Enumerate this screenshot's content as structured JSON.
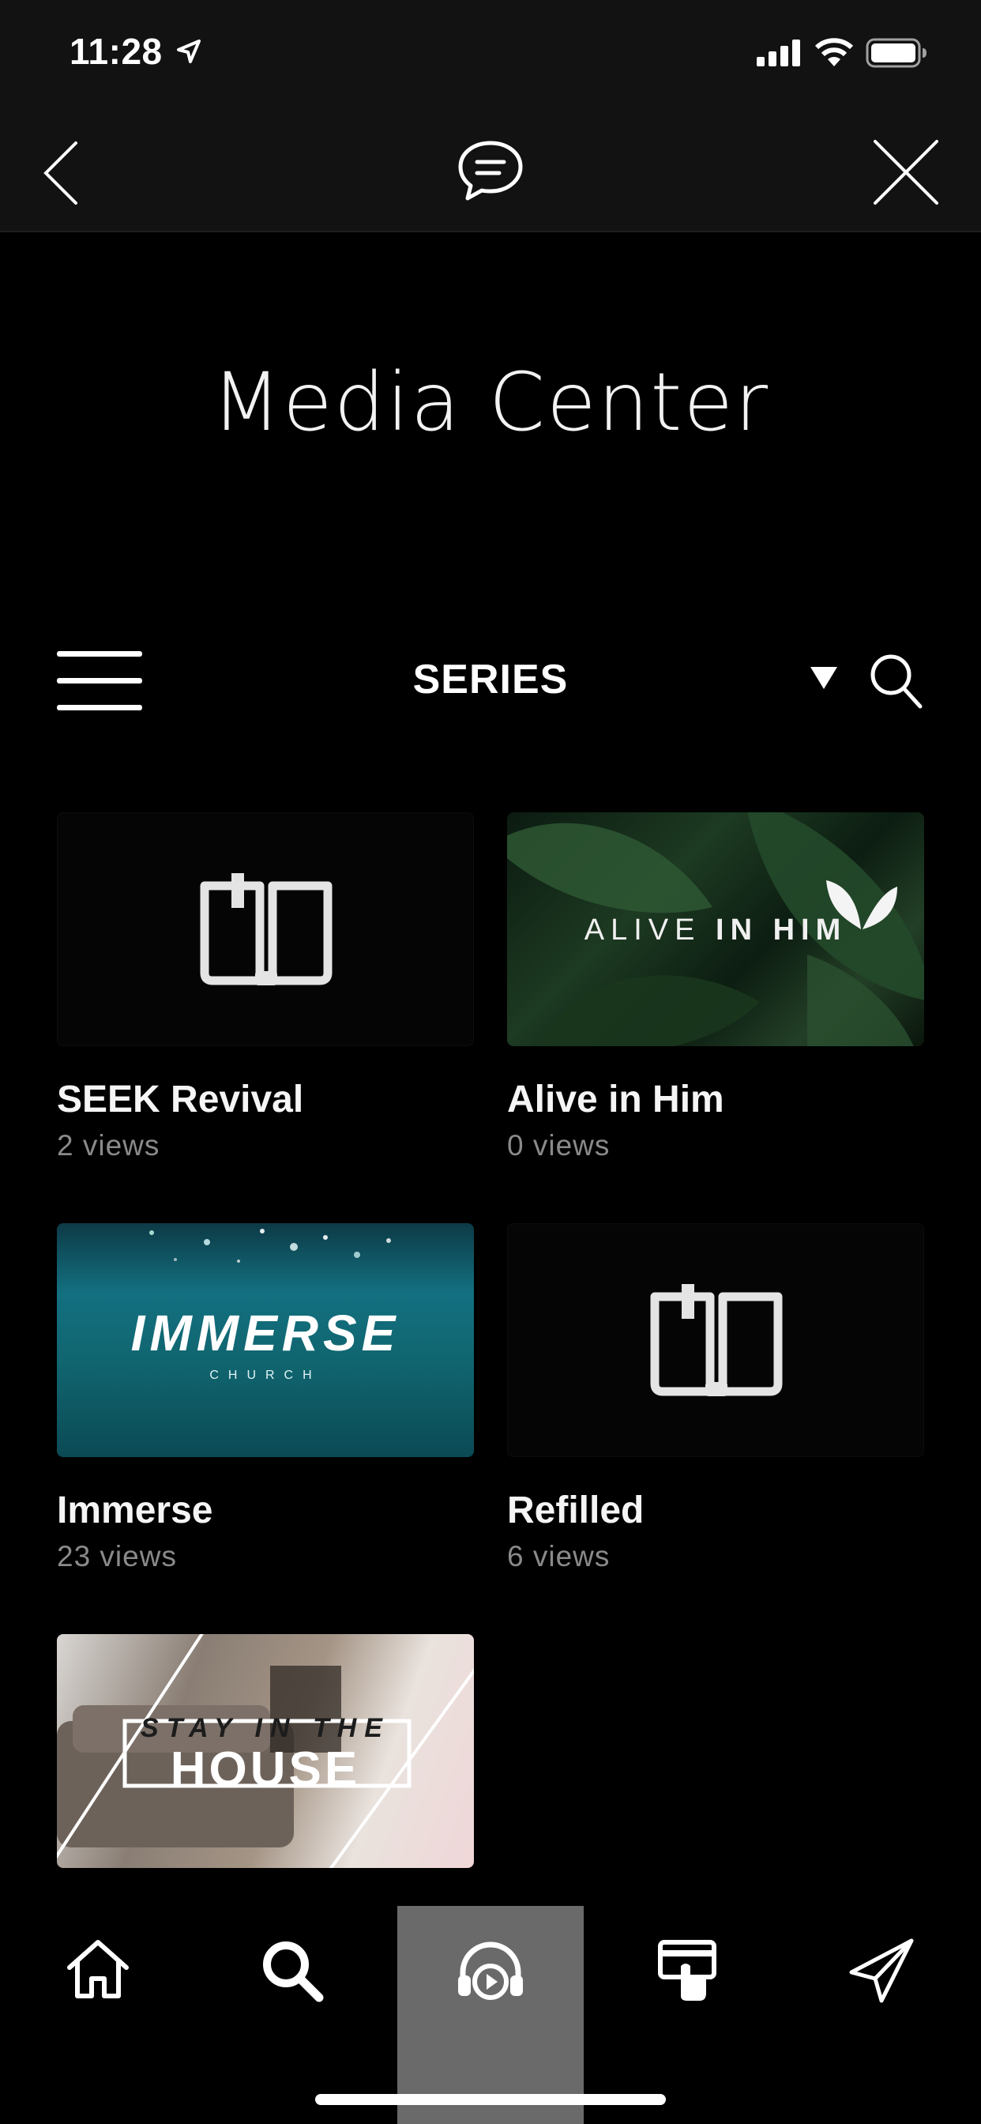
{
  "status_bar": {
    "time": "11:28"
  },
  "header": {
    "title": "Media Center"
  },
  "filter": {
    "label": "SERIES"
  },
  "series": [
    {
      "title": "SEEK Revival",
      "views": "2 views",
      "thumb": "book-placeholder"
    },
    {
      "title": "Alive in Him",
      "views": "0 views",
      "thumb": "alive-in-him",
      "thumb_text": {
        "regular": "ALIVE ",
        "bold": "IN HIM"
      }
    },
    {
      "title": "Immerse",
      "views": "23 views",
      "thumb": "immerse",
      "thumb_text": {
        "main": "IMMERSE",
        "sub": "CHURCH"
      }
    },
    {
      "title": "Refilled",
      "views": "6 views",
      "thumb": "book-placeholder"
    },
    {
      "title": "",
      "views": "",
      "thumb": "stay-in-the-house",
      "thumb_text": {
        "top": "STAY IN THE",
        "bottom": "HOUSE"
      }
    }
  ],
  "tab_bar": {
    "items": [
      {
        "name": "home",
        "icon": "home-icon"
      },
      {
        "name": "search",
        "icon": "search-icon"
      },
      {
        "name": "media",
        "icon": "headphones-play-icon",
        "active": true
      },
      {
        "name": "give",
        "icon": "card-hand-icon"
      },
      {
        "name": "send",
        "icon": "paper-plane-icon"
      }
    ]
  },
  "colors": {
    "background": "#000000",
    "bar": "#121212",
    "active_tab": "#6a6a6a",
    "muted_text": "#8a8a8a"
  }
}
